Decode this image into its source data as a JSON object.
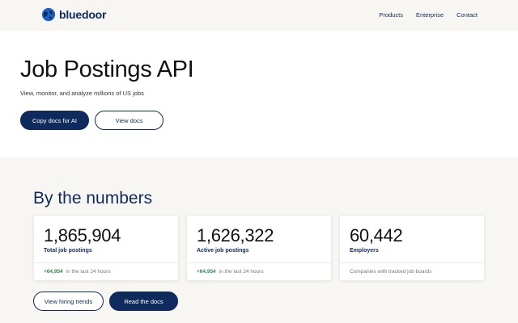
{
  "nav": {
    "logo_text": "bluedoor",
    "links": [
      "Products",
      "Enterprise",
      "Contact"
    ]
  },
  "hero": {
    "title": "Job Postings API",
    "subtitle": "View, monitor, and analyze millions of US jobs",
    "primary_button": "Copy docs for AI",
    "secondary_button": "View docs"
  },
  "stats": {
    "title": "By the numbers",
    "cards": [
      {
        "value": "1,865,904",
        "label": "Total job postings",
        "delta": "+64,954",
        "note": "in the last 24 hours"
      },
      {
        "value": "1,626,322",
        "label": "Active job postings",
        "delta": "+64,954",
        "note": "in the last 24 hours"
      },
      {
        "value": "60,442",
        "label": "Employers",
        "delta": "",
        "note": "Companies with tracked job boards"
      }
    ],
    "secondary_button": "View hiring trends",
    "primary_button": "Read the docs"
  },
  "colors": {
    "brand": "#0f2a5c",
    "positive": "#2f8a4e",
    "page_bg": "#f7f6f2"
  }
}
